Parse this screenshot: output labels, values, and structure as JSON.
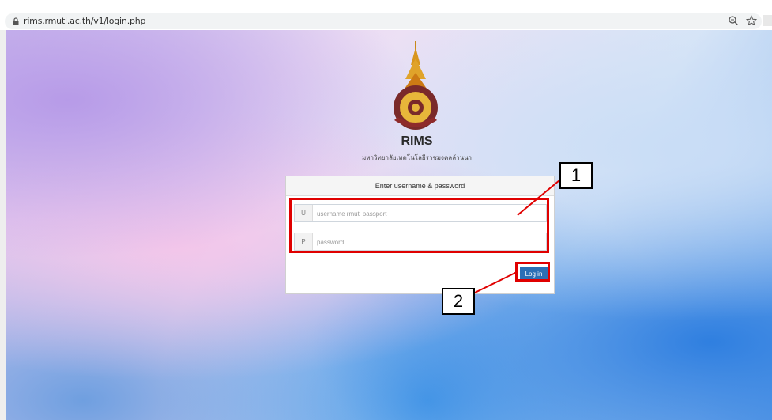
{
  "browser": {
    "url": "rims.rmutl.ac.th/v1/login.php",
    "icons": [
      "lock-icon",
      "zoom-icon",
      "bookmark-star-icon"
    ]
  },
  "header": {
    "title": "RIMS",
    "subtitle": "มหาวิทยาลัยเทคโนโลยีราชมงคลล้านนา"
  },
  "login": {
    "panel_title": "Enter username & password",
    "username_addon": "U",
    "username_placeholder": "username rmutl passport",
    "password_addon": "P",
    "password_placeholder": "password",
    "button_label": "Log in"
  },
  "annotations": {
    "callout_1": "1",
    "callout_2": "2",
    "highlight_color": "#e00000"
  },
  "colors": {
    "button": "#2c6fb5"
  }
}
